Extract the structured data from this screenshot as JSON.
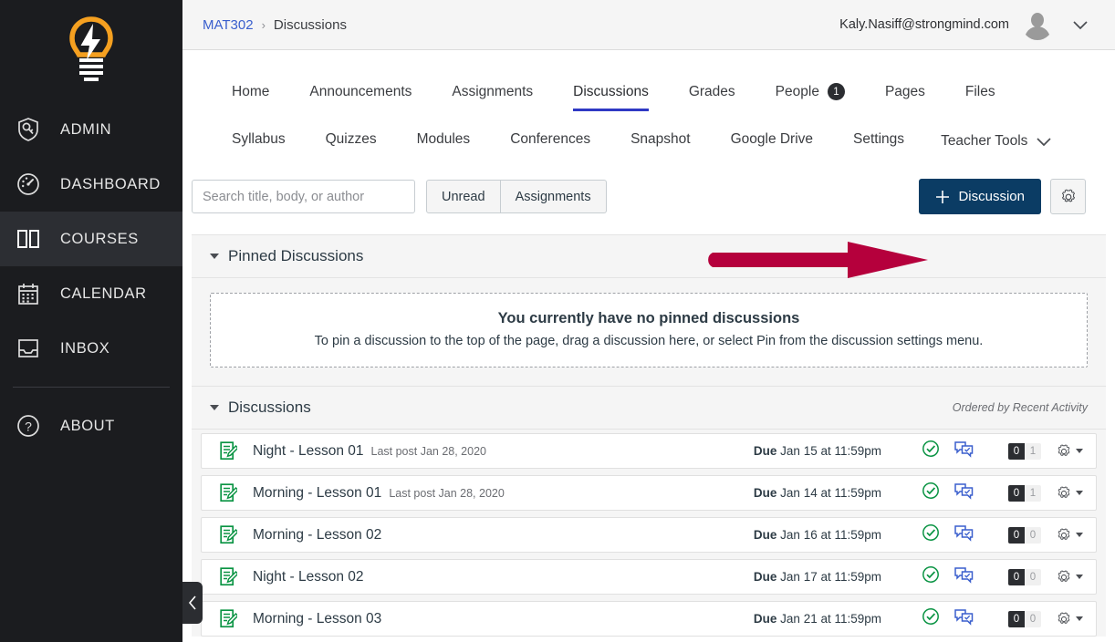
{
  "sidebar": {
    "logo_icon": "lightbulb-logo",
    "items": [
      {
        "label": "ADMIN",
        "icon": "shield-key-icon",
        "active": false
      },
      {
        "label": "DASHBOARD",
        "icon": "gauge-icon",
        "active": false
      },
      {
        "label": "COURSES",
        "icon": "book-icon",
        "active": true
      },
      {
        "label": "CALENDAR",
        "icon": "calendar-icon",
        "active": false
      },
      {
        "label": "INBOX",
        "icon": "inbox-icon",
        "active": false
      },
      {
        "label": "ABOUT",
        "icon": "question-circle-icon",
        "active": false
      }
    ],
    "collapse_icon": "chevron-left-icon"
  },
  "topbar": {
    "breadcrumb_course": "MAT302",
    "breadcrumb_separator": "›",
    "breadcrumb_current": "Discussions",
    "user_email": "Kaly.Nasiff@strongmind.com",
    "avatar_icon": "user-avatar",
    "caret_icon": "chevron-down-icon"
  },
  "course_nav": {
    "row1": [
      {
        "label": "Home",
        "active": false,
        "badge": null
      },
      {
        "label": "Announcements",
        "active": false,
        "badge": null
      },
      {
        "label": "Assignments",
        "active": false,
        "badge": null
      },
      {
        "label": "Discussions",
        "active": true,
        "badge": null
      },
      {
        "label": "Grades",
        "active": false,
        "badge": null
      },
      {
        "label": "People",
        "active": false,
        "badge": "1"
      },
      {
        "label": "Pages",
        "active": false,
        "badge": null
      },
      {
        "label": "Files",
        "active": false,
        "badge": null
      }
    ],
    "row2": [
      {
        "label": "Syllabus",
        "active": false,
        "badge": null
      },
      {
        "label": "Quizzes",
        "active": false,
        "badge": null
      },
      {
        "label": "Modules",
        "active": false,
        "badge": null
      },
      {
        "label": "Conferences",
        "active": false,
        "badge": null
      },
      {
        "label": "Snapshot",
        "active": false,
        "badge": null
      },
      {
        "label": "Google Drive",
        "active": false,
        "badge": null
      },
      {
        "label": "Settings",
        "active": false,
        "badge": null
      }
    ],
    "teacher_tools": {
      "label": "Teacher Tools",
      "caret_icon": "chevron-down-icon"
    }
  },
  "toolbar": {
    "search_placeholder": "Search title, body, or author",
    "search_value": "",
    "search_icon": "search-icon",
    "filter_unread": "Unread",
    "filter_assignments": "Assignments",
    "add_discussion_label": "Discussion",
    "add_discussion_plus": "+",
    "settings_icon": "gear-icon",
    "accent_button_color": "#0b3c64",
    "annotation_arrow_color": "#b5003c",
    "annotation_icon": "red-arrow-annotation"
  },
  "pinned": {
    "heading": "Pinned Discussions",
    "empty_title": "You currently have no pinned discussions",
    "empty_sub": "To pin a discussion to the top of the page, drag a discussion here, or select Pin from the discussion settings menu."
  },
  "discussions": {
    "heading": "Discussions",
    "ordered_by": "Ordered by Recent Activity",
    "rows": [
      {
        "icon": "discussion-assignment-icon",
        "title": "Night - Lesson 01",
        "meta": "Last post Jan 28, 2020",
        "due_label": "Due",
        "due_value": "Jan 15 at 11:59pm",
        "published_icon": "published-check-icon",
        "subscribe_icon": "subscribed-speech-icon",
        "unread_count": "0",
        "reply_count": "1",
        "gear_icon": "gear-icon",
        "caret_icon": "caret-down-icon"
      },
      {
        "icon": "discussion-assignment-icon",
        "title": "Morning - Lesson 01",
        "meta": "Last post Jan 28, 2020",
        "due_label": "Due",
        "due_value": "Jan 14 at 11:59pm",
        "published_icon": "published-check-icon",
        "subscribe_icon": "subscribed-speech-icon",
        "unread_count": "0",
        "reply_count": "1",
        "gear_icon": "gear-icon",
        "caret_icon": "caret-down-icon"
      },
      {
        "icon": "discussion-assignment-icon",
        "title": "Morning - Lesson 02",
        "meta": "",
        "due_label": "Due",
        "due_value": "Jan 16 at 11:59pm",
        "published_icon": "published-check-icon",
        "subscribe_icon": "subscribed-speech-icon",
        "unread_count": "0",
        "reply_count": "0",
        "gear_icon": "gear-icon",
        "caret_icon": "caret-down-icon"
      },
      {
        "icon": "discussion-assignment-icon",
        "title": "Night - Lesson 02",
        "meta": "",
        "due_label": "Due",
        "due_value": "Jan 17 at 11:59pm",
        "published_icon": "published-check-icon",
        "subscribe_icon": "subscribed-speech-icon",
        "unread_count": "0",
        "reply_count": "0",
        "gear_icon": "gear-icon",
        "caret_icon": "caret-down-icon"
      },
      {
        "icon": "discussion-assignment-icon",
        "title": "Morning - Lesson 03",
        "meta": "",
        "due_label": "Due",
        "due_value": "Jan 21 at 11:59pm",
        "published_icon": "published-check-icon",
        "subscribe_icon": "subscribed-speech-icon",
        "unread_count": "0",
        "reply_count": "0",
        "gear_icon": "gear-icon",
        "caret_icon": "caret-down-icon"
      }
    ]
  }
}
